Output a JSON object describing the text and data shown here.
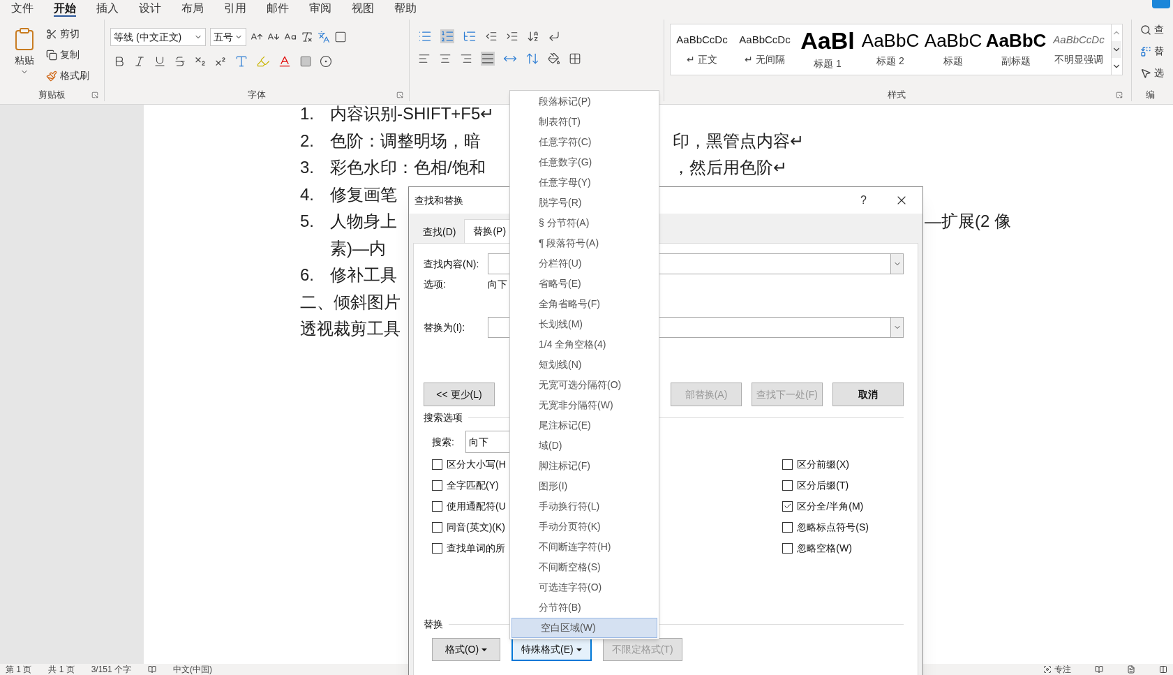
{
  "menu_tabs": [
    {
      "label": "文件",
      "selected": false
    },
    {
      "label": "开始",
      "selected": true
    },
    {
      "label": "插入",
      "selected": false
    },
    {
      "label": "设计",
      "selected": false
    },
    {
      "label": "布局",
      "selected": false
    },
    {
      "label": "引用",
      "selected": false
    },
    {
      "label": "邮件",
      "selected": false
    },
    {
      "label": "审阅",
      "selected": false
    },
    {
      "label": "视图",
      "selected": false
    },
    {
      "label": "帮助",
      "selected": false
    }
  ],
  "ribbon": {
    "clipboard": {
      "paste": "粘贴",
      "items": [
        "剪切",
        "复制",
        "格式刷"
      ],
      "label": "剪贴板"
    },
    "font": {
      "font_name": "等线 (中文正文)",
      "font_size": "五号",
      "label": "字体"
    },
    "styles": {
      "label": "样式",
      "items": [
        {
          "preview": "AaBbCcDc",
          "name": "↵ 正文",
          "kind": "body"
        },
        {
          "preview": "AaBbCcDc",
          "name": "↵ 无间隔",
          "kind": "body"
        },
        {
          "preview": "AaBl",
          "name": "标题 1",
          "kind": "heading1"
        },
        {
          "preview": "AaBbC",
          "name": "标题 2",
          "kind": "heading2"
        },
        {
          "preview": "AaBbC",
          "name": "标题",
          "kind": "heading2"
        },
        {
          "preview": "AaBbC",
          "name": "副标题",
          "kind": "subtitle"
        },
        {
          "preview": "AaBbCcDc",
          "name": "不明显强调",
          "kind": "emphasis"
        }
      ]
    },
    "editing": {
      "items": [
        "查",
        "替",
        "选"
      ],
      "label": "编"
    }
  },
  "document": {
    "lines": [
      {
        "kind": "item",
        "number": "1.",
        "left": "内容识别-SHIFT+F5↵"
      },
      {
        "kind": "item",
        "number": "2.",
        "left": "色阶：调整明场，暗",
        "right": {
          "kind": "after_menu",
          "text": "印，黑管点内容↵"
        }
      },
      {
        "kind": "item",
        "number": "3.",
        "left": "彩色水印：色相/饱和",
        "right": {
          "kind": "after_menu",
          "text": "，然后用色阶↵"
        }
      },
      {
        "kind": "item",
        "number": "4.",
        "left": "修复画笔"
      },
      {
        "kind": "item",
        "number": "5.",
        "left": "人物身上",
        "right": {
          "kind": "after_dialog",
          "text": "—扩展(2 像"
        }
      },
      {
        "kind": "continuation",
        "left": "素)—内"
      },
      {
        "kind": "item",
        "number": "6.",
        "left": "修补工具"
      },
      {
        "kind": "plain",
        "left": "二、倾斜图片"
      },
      {
        "kind": "plain",
        "left": "透视裁剪工具"
      }
    ]
  },
  "dialog": {
    "title": "查找和替换",
    "help": "?",
    "tabs": [
      {
        "label": "查找(D)",
        "selected": false
      },
      {
        "label": "替换(P)",
        "selected": true
      }
    ],
    "find_label": "查找内容(N):",
    "options_label": "选项:",
    "options_value": "向下",
    "replace_label": "替换为(I):",
    "buttons": [
      {
        "label": "<< 更少(L)",
        "disabled": false
      },
      {
        "label": "部替换(A)",
        "disabled": true
      },
      {
        "label": "查找下一处(F)",
        "disabled": true
      },
      {
        "label": "取消",
        "disabled": false
      }
    ],
    "search_title": "搜索选项",
    "search_label": "搜索:",
    "search_value": "向下",
    "left_checks": [
      {
        "label": "区分大小写(H",
        "checked": false
      },
      {
        "label": "全字匹配(Y)",
        "checked": false
      },
      {
        "label": "使用通配符(U",
        "checked": false
      },
      {
        "label": "同音(英文)(K)",
        "checked": false
      },
      {
        "label": "查找单词的所",
        "checked": false
      }
    ],
    "right_checks": [
      {
        "label": "区分前缀(X)",
        "checked": false
      },
      {
        "label": "区分后缀(T)",
        "checked": false
      },
      {
        "label": "区分全/半角(M)",
        "checked": true
      },
      {
        "label": "忽略标点符号(S)",
        "checked": false
      },
      {
        "label": "忽略空格(W)",
        "checked": false
      }
    ],
    "replace_title": "替换",
    "replace_buttons": [
      {
        "label": "格式(O)",
        "kind": "dropdown",
        "disabled": false,
        "focused": false
      },
      {
        "label": "特殊格式(E)",
        "kind": "dropdown",
        "disabled": false,
        "focused": true
      },
      {
        "label": "不限定格式(T)",
        "kind": "plain",
        "disabled": true,
        "focused": false
      }
    ]
  },
  "special_menu": {
    "items": [
      {
        "label": "段落标记(P)",
        "selected": false
      },
      {
        "label": "制表符(T)",
        "selected": false
      },
      {
        "label": "任意字符(C)",
        "selected": false
      },
      {
        "label": "任意数字(G)",
        "selected": false
      },
      {
        "label": "任意字母(Y)",
        "selected": false
      },
      {
        "label": "脱字号(R)",
        "selected": false
      },
      {
        "label": "§ 分节符(A)",
        "selected": false
      },
      {
        "label": "¶ 段落符号(A)",
        "selected": false
      },
      {
        "label": "分栏符(U)",
        "selected": false
      },
      {
        "label": "省略号(E)",
        "selected": false
      },
      {
        "label": "全角省略号(F)",
        "selected": false
      },
      {
        "label": "长划线(M)",
        "selected": false
      },
      {
        "label": "1/4 全角空格(4)",
        "selected": false
      },
      {
        "label": "短划线(N)",
        "selected": false
      },
      {
        "label": "无宽可选分隔符(O)",
        "selected": false
      },
      {
        "label": "无宽非分隔符(W)",
        "selected": false
      },
      {
        "label": "尾注标记(E)",
        "selected": false
      },
      {
        "label": "域(D)",
        "selected": false
      },
      {
        "label": "脚注标记(F)",
        "selected": false
      },
      {
        "label": "图形(I)",
        "selected": false
      },
      {
        "label": "手动换行符(L)",
        "selected": false
      },
      {
        "label": "手动分页符(K)",
        "selected": false
      },
      {
        "label": "不间断连字符(H)",
        "selected": false
      },
      {
        "label": "不间断空格(S)",
        "selected": false
      },
      {
        "label": "可选连字符(O)",
        "selected": false
      },
      {
        "label": "分节符(B)",
        "selected": false
      },
      {
        "label": "空白区域(W)",
        "selected": true
      }
    ]
  },
  "status_bar": {
    "left": [
      "第 1 页",
      "共 1 页",
      "3/151 个字",
      "中文(中国)"
    ],
    "focus": "专注"
  }
}
